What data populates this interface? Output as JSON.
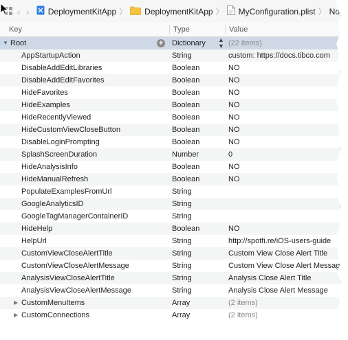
{
  "breadcrumb": {
    "items": [
      {
        "label": "DeploymentKitApp",
        "icon": "xcode-project-icon"
      },
      {
        "label": "DeploymentKitApp",
        "icon": "folder-icon"
      },
      {
        "label": "MyConfiguration.plist",
        "icon": "plist-file-icon"
      },
      {
        "label": "No",
        "icon": ""
      }
    ]
  },
  "columns": {
    "key": "Key",
    "type": "Type",
    "value": "Value"
  },
  "root": {
    "key": "Root",
    "type": "Dictionary",
    "value": "(22 items)"
  },
  "rows": [
    {
      "key": "AppStartupAction",
      "type": "String",
      "value": "custom: https://docs.tibco.com"
    },
    {
      "key": "DisableAddEditLibraries",
      "type": "Boolean",
      "value": "NO"
    },
    {
      "key": "DisableAddEditFavorites",
      "type": "Boolean",
      "value": "NO"
    },
    {
      "key": "HideFavorites",
      "type": "Boolean",
      "value": "NO"
    },
    {
      "key": "HideExamples",
      "type": "Boolean",
      "value": "NO"
    },
    {
      "key": "HideRecentlyViewed",
      "type": "Boolean",
      "value": "NO"
    },
    {
      "key": "HideCustomViewCloseButton",
      "type": "Boolean",
      "value": "NO"
    },
    {
      "key": "DisableLoginPrompting",
      "type": "Boolean",
      "value": "NO"
    },
    {
      "key": "SplashScreenDuration",
      "type": "Number",
      "value": "0"
    },
    {
      "key": "HideAnalysisInfo",
      "type": "Boolean",
      "value": "NO"
    },
    {
      "key": "HideManualRefresh",
      "type": "Boolean",
      "value": "NO"
    },
    {
      "key": "PopulateExamplesFromUrl",
      "type": "String",
      "value": ""
    },
    {
      "key": "GoogleAnalyticsID",
      "type": "String",
      "value": ""
    },
    {
      "key": "GoogleTagManagerContainerID",
      "type": "String",
      "value": ""
    },
    {
      "key": "HideHelp",
      "type": "Boolean",
      "value": "NO"
    },
    {
      "key": "HelpUrl",
      "type": "String",
      "value": "http://spotfi.re/iOS-users-guide"
    },
    {
      "key": "CustomViewCloseAlertTitle",
      "type": "String",
      "value": "Custom View Close Alert Title"
    },
    {
      "key": "CustomViewCloseAlertMessage",
      "type": "String",
      "value": "Custom View Close Alert Message"
    },
    {
      "key": "AnalysisViewCloseAlertTitle",
      "type": "String",
      "value": "Analysis Close Alert Title"
    },
    {
      "key": "AnalysisViewCloseAlertMessage",
      "type": "String",
      "value": "Analysis Close Alert Message"
    }
  ],
  "collapsed_rows": [
    {
      "key": "CustomMenuItems",
      "type": "Array",
      "value": "(2 items)"
    },
    {
      "key": "CustomConnections",
      "type": "Array",
      "value": "(2 items)"
    }
  ],
  "colors": {
    "selection": "#cfd9e6",
    "stripe": "#f4f5f5",
    "folder": "#f5c342",
    "project": "#2f7fe0"
  }
}
